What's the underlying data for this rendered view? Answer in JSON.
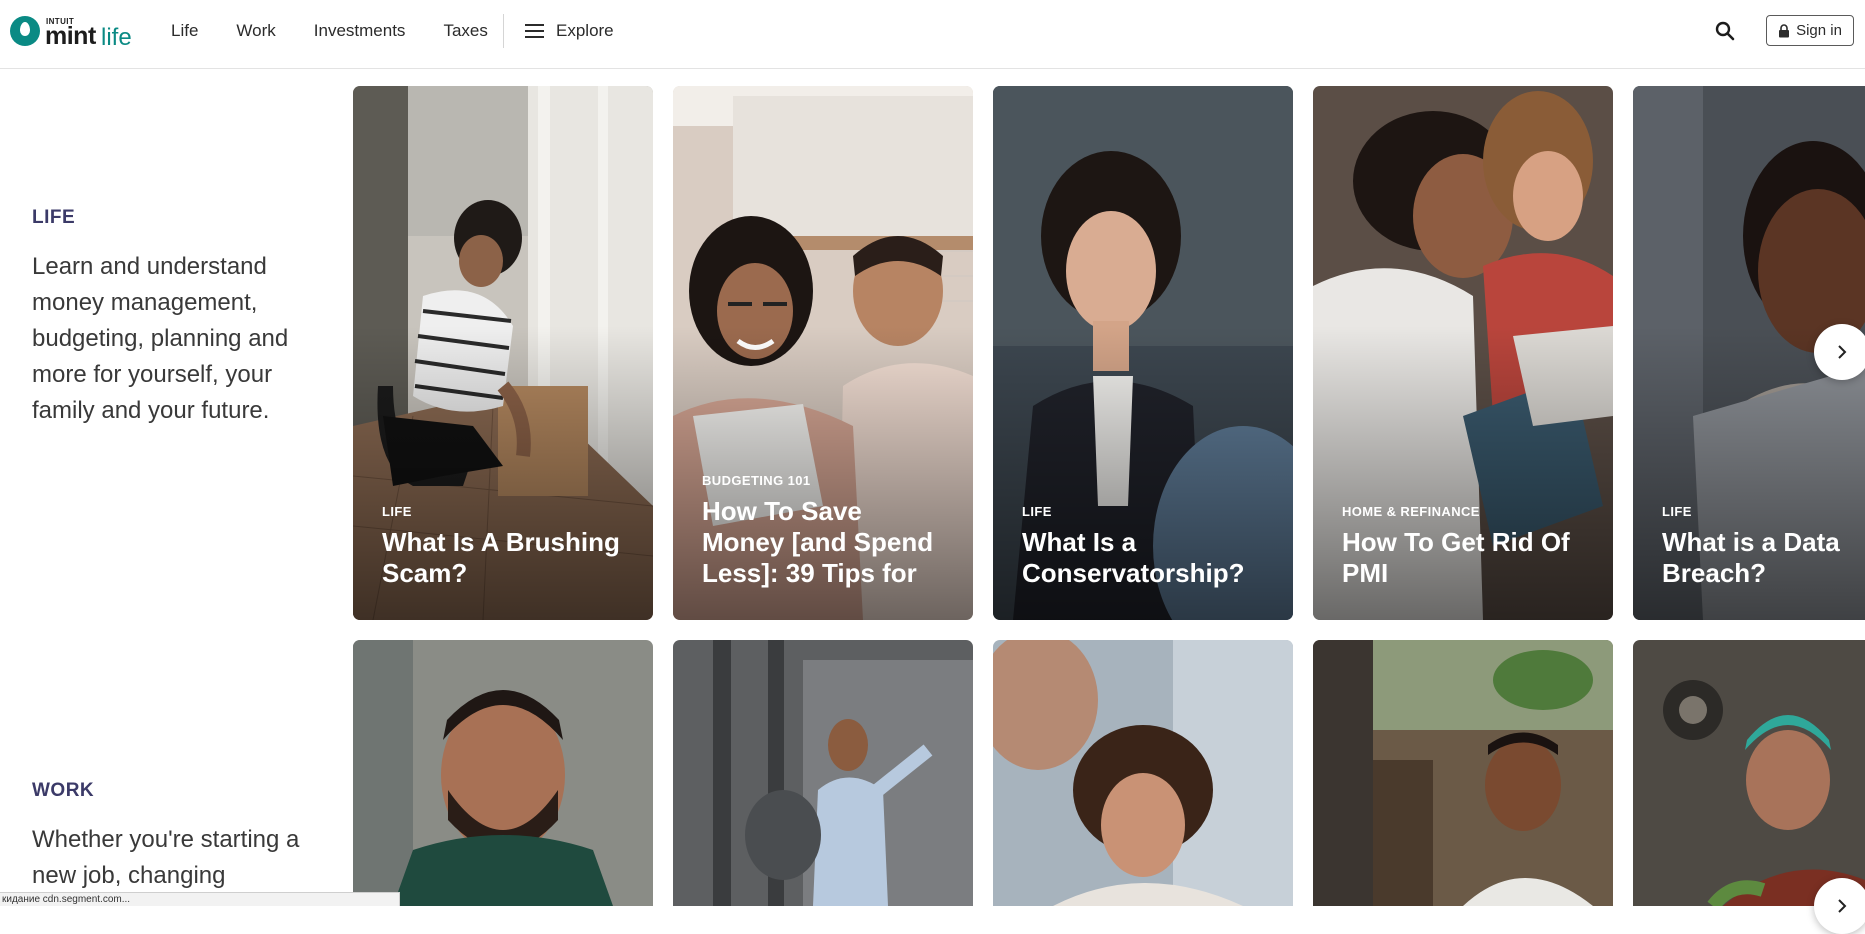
{
  "header": {
    "logo": {
      "intuit": "INTUIT",
      "mint": "mint",
      "life": "life"
    },
    "nav": [
      {
        "label": "Life"
      },
      {
        "label": "Work"
      },
      {
        "label": "Investments"
      },
      {
        "label": "Taxes"
      }
    ],
    "explore_label": "Explore",
    "search_icon": "search-icon",
    "signin_label": "Sign in",
    "signin_icon": "lock-icon"
  },
  "sections": {
    "life": {
      "title": "LIFE",
      "description": "Learn and understand money management, budgeting, planning and more for yourself, your family and your future."
    },
    "work": {
      "title": "WORK",
      "description": "Whether you're starting a new job, changing"
    }
  },
  "life_cards": [
    {
      "category": "LIFE",
      "title": "What Is A Brushing Scam?"
    },
    {
      "category": "BUDGETING 101",
      "title": "How To Save Money [and Spend Less]: 39 Tips for"
    },
    {
      "category": "LIFE",
      "title": "What Is a Conservatorship?"
    },
    {
      "category": "HOME & REFINANCE",
      "title": "How To Get Rid Of PMI"
    },
    {
      "category": "LIFE",
      "title": "What is a Data Breach?"
    }
  ],
  "status_bar": "кидание cdn.segment.com...",
  "colors": {
    "brand_teal": "#0a8a84",
    "section_title": "#3b3a68",
    "text": "#393939"
  }
}
